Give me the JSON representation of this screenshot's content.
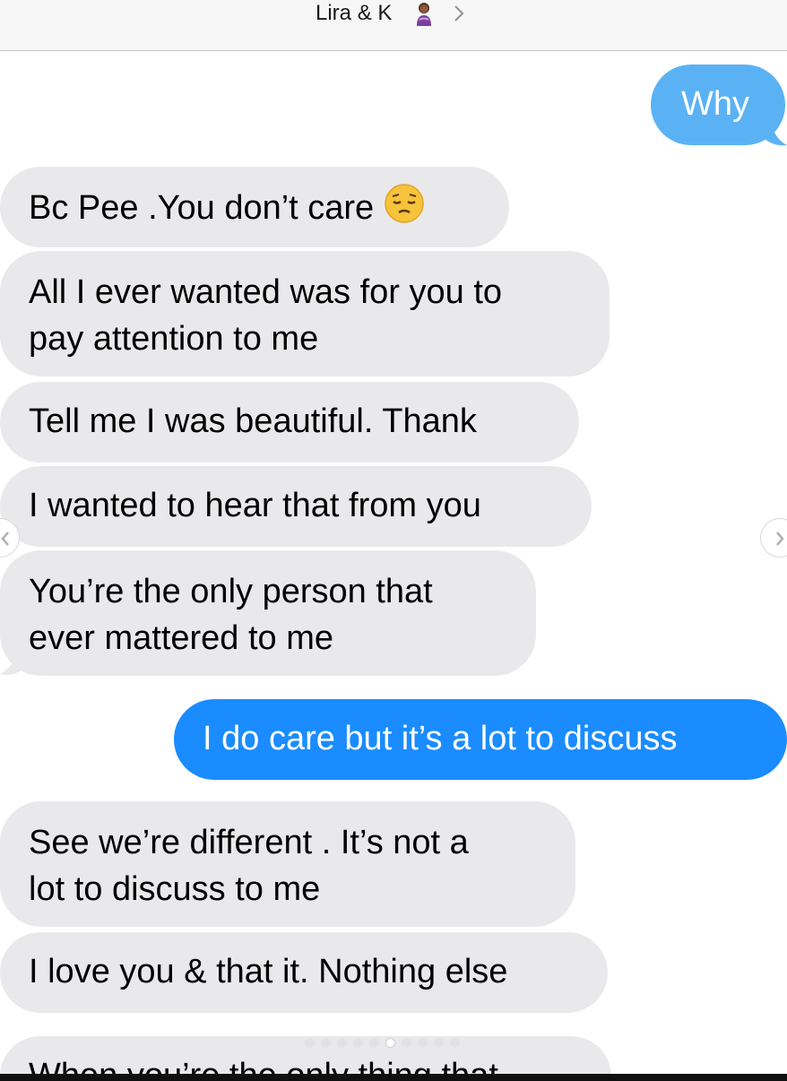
{
  "header": {
    "title": "Lira & K",
    "avatar_icon": "person-emoji-icon",
    "chevron_icon": "chevron-right-icon"
  },
  "colors": {
    "sent_bubble": "#1a8cff",
    "sent_delivered": "#5ab2f5",
    "received_bubble": "#e9e9eb"
  },
  "messages": [
    {
      "direction": "sent",
      "text": "Why"
    },
    {
      "direction": "received",
      "text": "Bc Pee .You don’t care",
      "emoji": "pensive-face-icon"
    },
    {
      "direction": "received",
      "lines": [
        "All I ever wanted was for you to",
        "pay attention to me"
      ]
    },
    {
      "direction": "received",
      "text": "Tell me I was beautiful. Thank"
    },
    {
      "direction": "received",
      "text": "I wanted to hear that from you"
    },
    {
      "direction": "received",
      "lines": [
        "You’re the only person that",
        "ever mattered to me"
      ]
    },
    {
      "direction": "sent",
      "text": "I do care but it’s a lot to discuss"
    },
    {
      "direction": "received",
      "lines": [
        "See we’re different . It’s not a",
        "lot to discuss to me"
      ]
    },
    {
      "direction": "received",
      "text": "I love you & that it. Nothing else"
    },
    {
      "direction": "received",
      "text": "When you’re the only thing that"
    }
  ],
  "carousel": {
    "prev_icon": "chevron-left-icon",
    "next_icon": "chevron-right-icon",
    "page_count": 10,
    "active_page": 5
  }
}
